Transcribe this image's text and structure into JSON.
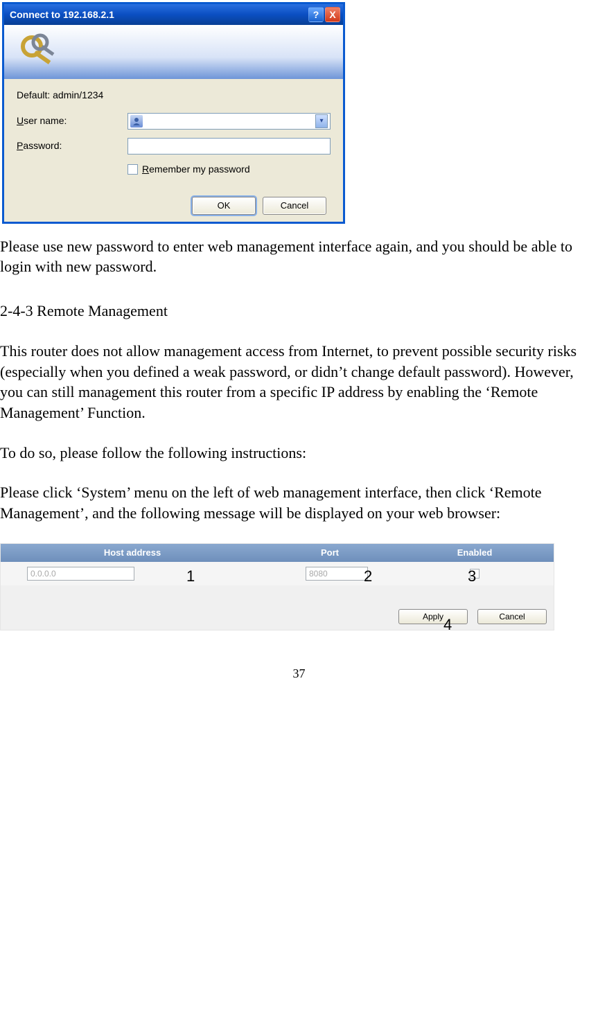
{
  "dialog": {
    "title": "Connect to 192.168.2.1",
    "hint": "Default: admin/1234",
    "username_label_pre": "U",
    "username_label_post": "ser name:",
    "password_label_pre": "P",
    "password_label_post": "assword:",
    "remember_pre": "R",
    "remember_post": "emember my password",
    "ok": "OK",
    "cancel": "Cancel",
    "help_symbol": "?",
    "close_symbol": "X"
  },
  "body": {
    "p1": "Please use new password to enter web management interface again, and you should be able to login with new password.",
    "section": "2-4-3 Remote Management",
    "p2": "This router does not allow management access from Internet, to prevent possible security risks (especially when you defined a weak password, or didn’t change default password). However, you can still management this router from a specific IP address by enabling the ‘Remote Management’ Function.",
    "p3": "To do so, please follow the following instructions:",
    "p4": "Please click ‘System’ menu on the left of web management interface, then click ‘Remote Management’, and the following message will be displayed on your web browser:"
  },
  "rm": {
    "head_host": "Host address",
    "head_port": "Port",
    "head_enabled": "Enabled",
    "host_value": "0.0.0.0",
    "port_value": "8080",
    "apply": "Apply",
    "cancel": "Cancel"
  },
  "labels": {
    "n1": "1",
    "n2": "2",
    "n3": "3",
    "n4": "4"
  },
  "page_number": "37"
}
